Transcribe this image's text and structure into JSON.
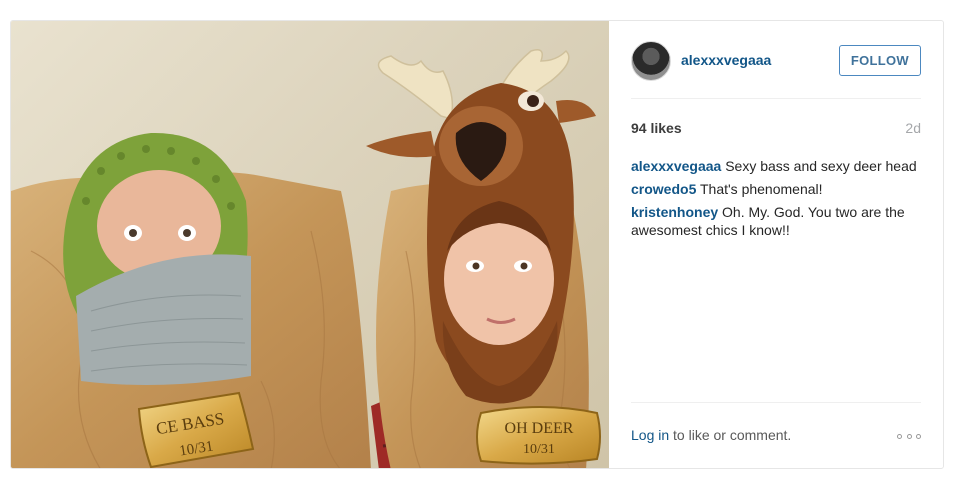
{
  "post": {
    "image": {
      "plaques": [
        "CE BASS",
        "10/31",
        "OH DEER",
        "10/31"
      ]
    },
    "author": {
      "username": "alexxxvegaaa",
      "avatar_icon": "user-avatar"
    },
    "follow_label": "FOLLOW",
    "likes": "94 likes",
    "time_ago": "2d",
    "comments": [
      {
        "author": "alexxxvegaaa",
        "text": "Sexy bass and sexy deer head"
      },
      {
        "author": "crowedo5",
        "text": "That's phenomenal!"
      },
      {
        "author": "kristenhoney",
        "text": "Oh. My. God. You two are the awesomest chics I know!!"
      }
    ],
    "footer": {
      "login_link": "Log in",
      "login_suffix": " to like or comment.",
      "more_icon": "ellipsis-icon"
    }
  },
  "colors": {
    "link": "#125688",
    "follow_border": "#4c88c0",
    "muted": "#a5a7aa"
  }
}
